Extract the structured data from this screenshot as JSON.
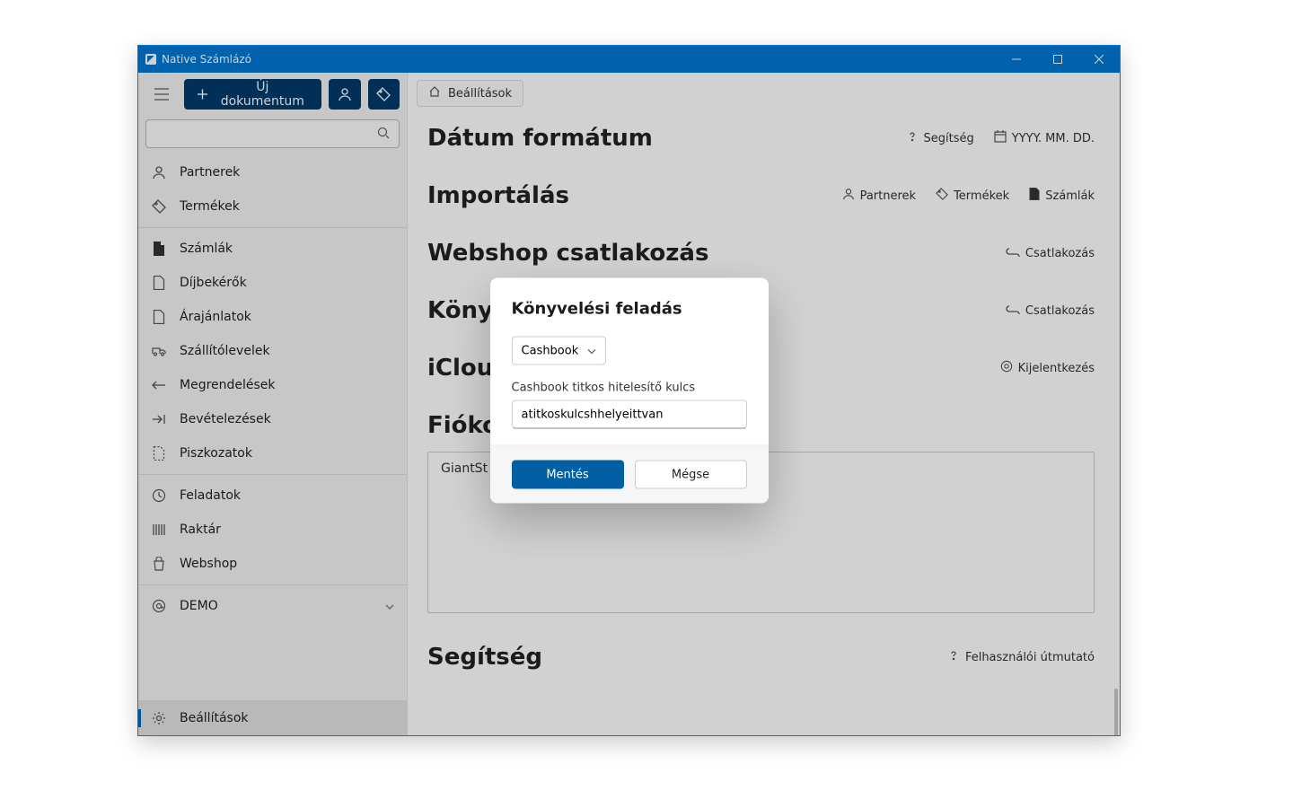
{
  "titlebar": {
    "title": "Native Számlázó"
  },
  "toolbar": {
    "new_doc_label": "Új dokumentum"
  },
  "breadcrumb": {
    "label": "Beállítások"
  },
  "nav": {
    "group1": [
      {
        "icon": "person",
        "label": "Partnerek"
      },
      {
        "icon": "tag",
        "label": "Termékek"
      }
    ],
    "group2": [
      {
        "icon": "doc-filled",
        "label": "Számlák"
      },
      {
        "icon": "doc",
        "label": "Díjbekérők"
      },
      {
        "icon": "doc",
        "label": "Árajánlatok"
      },
      {
        "icon": "truck",
        "label": "Szállítólevelek"
      },
      {
        "icon": "arrow-left",
        "label": "Megrendelések"
      },
      {
        "icon": "arrow-in",
        "label": "Bevételezések"
      },
      {
        "icon": "draft",
        "label": "Piszkozatok"
      }
    ],
    "group3": [
      {
        "icon": "clock",
        "label": "Feladatok"
      },
      {
        "icon": "barcode",
        "label": "Raktár"
      },
      {
        "icon": "bag",
        "label": "Webshop"
      }
    ],
    "group4": [
      {
        "icon": "at",
        "label": "DEMO",
        "chev": true
      }
    ],
    "bottom": {
      "icon": "gear",
      "label": "Beállítások"
    }
  },
  "sections": {
    "date": {
      "title": "Dátum formátum",
      "help": "Segítség",
      "value": "YYYY. MM. DD."
    },
    "import": {
      "title": "Importálás",
      "links": [
        "Partnerek",
        "Termékek",
        "Számlák"
      ]
    },
    "webshop": {
      "title": "Webshop csatlakozás",
      "action": "Csatlakozás"
    },
    "accounting": {
      "title": "Köny",
      "action": "Csatlakozás"
    },
    "icloud": {
      "title": "iClou",
      "action": "Kijelentkezés"
    },
    "accounts": {
      "title": "Fióko",
      "value": "GiantSt"
    },
    "help": {
      "title": "Segítség",
      "action": "Felhasználói útmutató"
    }
  },
  "modal": {
    "title": "Könyvelési feladás",
    "select_value": "Cashbook",
    "field_label": "Cashbook titkos hitelesítő kulcs",
    "field_value": "atitkoskulcshhelyeittvan",
    "save": "Mentés",
    "cancel": "Mégse"
  }
}
